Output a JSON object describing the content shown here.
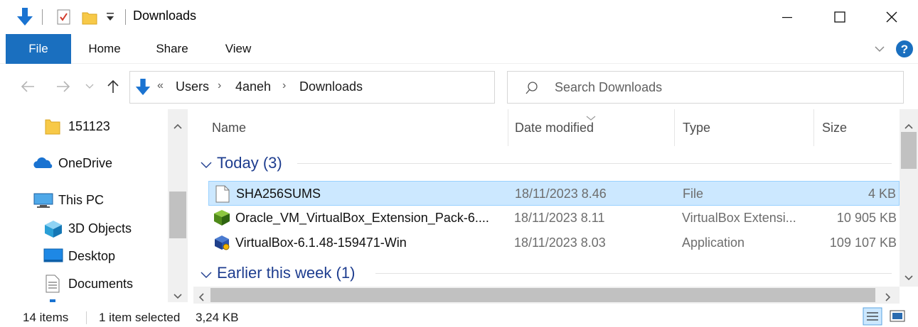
{
  "window": {
    "title": "Downloads",
    "controls": [
      "minimize",
      "maximize",
      "close"
    ]
  },
  "ribbon": {
    "tabs": [
      {
        "label": "File",
        "active": true
      },
      {
        "label": "Home"
      },
      {
        "label": "Share"
      },
      {
        "label": "View"
      }
    ]
  },
  "address": {
    "crumbs": [
      "Users",
      "4aneh",
      "Downloads"
    ],
    "overflow": "«",
    "separator": "›"
  },
  "search": {
    "placeholder": "Search Downloads"
  },
  "navpane": {
    "items": [
      {
        "label": "151123",
        "icon": "folder-icon"
      },
      {
        "label": "OneDrive",
        "icon": "onedrive-cloud-icon"
      },
      {
        "label": "This PC",
        "icon": "computer-icon"
      },
      {
        "label": "3D Objects",
        "icon": "3d-objects-icon"
      },
      {
        "label": "Desktop",
        "icon": "desktop-icon"
      },
      {
        "label": "Documents",
        "icon": "documents-icon"
      }
    ]
  },
  "columns": {
    "name": "Name",
    "date": "Date modified",
    "type": "Type",
    "size": "Size"
  },
  "groups": [
    {
      "label": "Today (3)",
      "files": [
        {
          "name": "SHA256SUMS",
          "date": "18/11/2023 8.46",
          "type": "File",
          "size": "4 KB",
          "icon": "blank-file-icon",
          "selected": true
        },
        {
          "name": "Oracle_VM_VirtualBox_Extension_Pack-6....",
          "date": "18/11/2023 8.11",
          "type": "VirtualBox Extensi...",
          "size": "10 905 KB",
          "icon": "virtualbox-extension-icon",
          "selected": false
        },
        {
          "name": "VirtualBox-6.1.48-159471-Win",
          "date": "18/11/2023 8.03",
          "type": "Application",
          "size": "109 107 KB",
          "icon": "virtualbox-installer-icon",
          "selected": false
        }
      ]
    },
    {
      "label": "Earlier this week (1)",
      "files": []
    }
  ],
  "status": {
    "item_count": "14 items",
    "selection": "1 item selected",
    "selection_size": "3,24 KB"
  },
  "colors": {
    "accent": "#1a6fbf",
    "selection_bg": "#cce8ff",
    "selection_border": "#99d1ff",
    "group_text": "#1e3d8f"
  }
}
